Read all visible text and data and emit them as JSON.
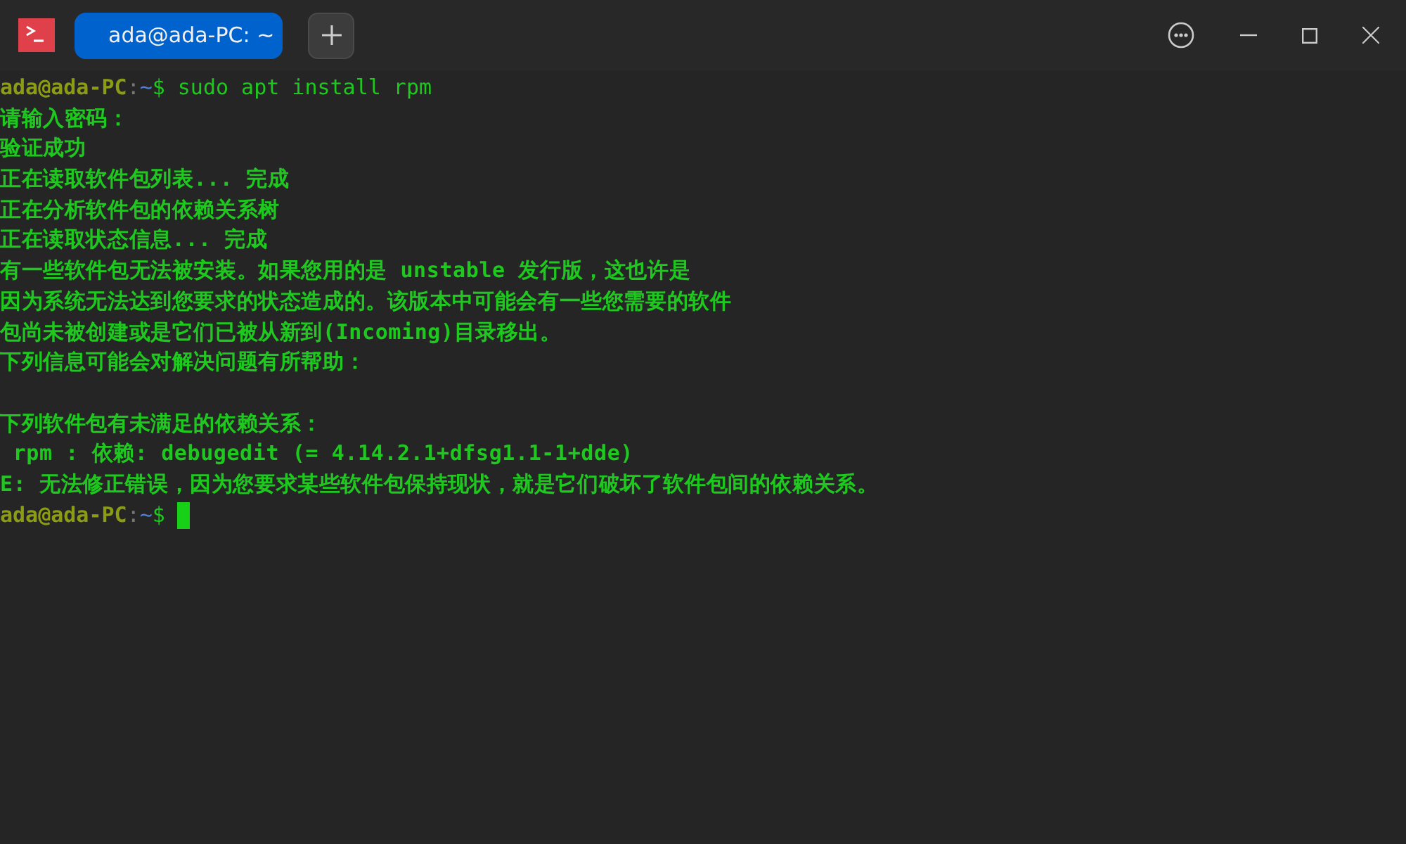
{
  "tabs": [
    {
      "label": "ada@ada-PC: ~",
      "selected": true
    }
  ],
  "lines": [
    {
      "kind": "prompt",
      "user": "ada@ada-PC",
      "separator": ":",
      "path": "~",
      "symbol": "$",
      "command": "sudo apt install rpm"
    },
    {
      "kind": "output",
      "text": "请输入密码："
    },
    {
      "kind": "output",
      "text": "验证成功"
    },
    {
      "kind": "output",
      "text": "正在读取软件包列表... 完成"
    },
    {
      "kind": "output",
      "text": "正在分析软件包的依赖关系树"
    },
    {
      "kind": "output",
      "text": "正在读取状态信息... 完成"
    },
    {
      "kind": "output",
      "text": "有一些软件包无法被安装。如果您用的是 unstable 发行版，这也许是"
    },
    {
      "kind": "output",
      "text": "因为系统无法达到您要求的状态造成的。该版本中可能会有一些您需要的软件"
    },
    {
      "kind": "output",
      "text": "包尚未被创建或是它们已被从新到(Incoming)目录移出。"
    },
    {
      "kind": "output",
      "text": "下列信息可能会对解决问题有所帮助："
    },
    {
      "kind": "blank"
    },
    {
      "kind": "output",
      "text": "下列软件包有未满足的依赖关系："
    },
    {
      "kind": "output",
      "text": " rpm : 依赖: debugedit (= 4.14.2.1+dfsg1.1-1+dde)"
    },
    {
      "kind": "output",
      "text": "E: 无法修正错误，因为您要求某些软件包保持现状，就是它们破坏了软件包间的依赖关系。"
    },
    {
      "kind": "prompt",
      "user": "ada@ada-PC",
      "separator": ":",
      "path": "~",
      "symbol": "$",
      "cursor": true
    }
  ]
}
